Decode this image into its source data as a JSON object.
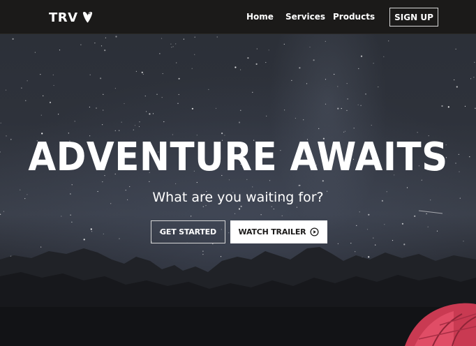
{
  "brand": {
    "name": "TRV",
    "icon": "typo3-logo-icon",
    "accent_color": "#ffffff"
  },
  "nav": {
    "links": [
      {
        "label": "Home"
      },
      {
        "label": "Services"
      },
      {
        "label": "Products"
      }
    ],
    "signup_label": "SIGN UP"
  },
  "hero": {
    "headline": "ADVENTURE AWAITS",
    "subheadline": "What are you waiting for?",
    "primary_button": "GET STARTED",
    "secondary_button": "WATCH TRAILER",
    "secondary_button_icon": "play-circle-icon",
    "background": "starry night sky over mountains with a red tent"
  },
  "colors": {
    "navbar": "#1b1a19",
    "tent": "#d8415a"
  }
}
